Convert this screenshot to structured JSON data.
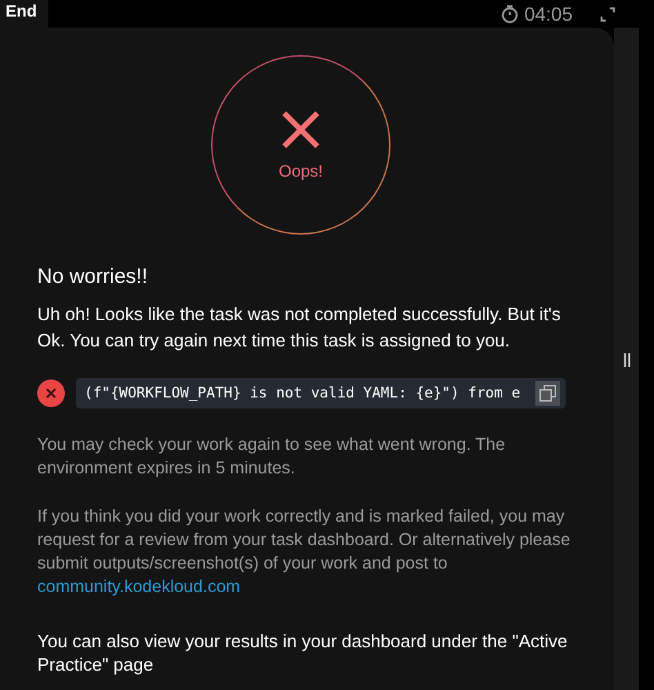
{
  "top_bar": {
    "end_button": "End",
    "timer": "04:05"
  },
  "result": {
    "status_label": "Oops!"
  },
  "heading": "No worries!!",
  "intro": "Uh oh! Looks like the task was not completed successfully. But it's Ok. You can try again next time this task is assigned to you.",
  "error": {
    "code": "(f\"{WORKFLOW_PATH} is not valid YAML: {e}\") from e"
  },
  "notes": [
    {
      "text": "You may check your work again to see what went wrong. The environment expires in 5 minutes."
    },
    {
      "text": "If you think you did your work correctly and is marked failed, you may request for a review from your task dashboard. Or alternatively please submit outputs/screenshot(s) of your work and post to",
      "link": "community.kodekloud.com"
    }
  ],
  "footer": "You can also view your results in your dashboard under the \"Active Practice\" page"
}
